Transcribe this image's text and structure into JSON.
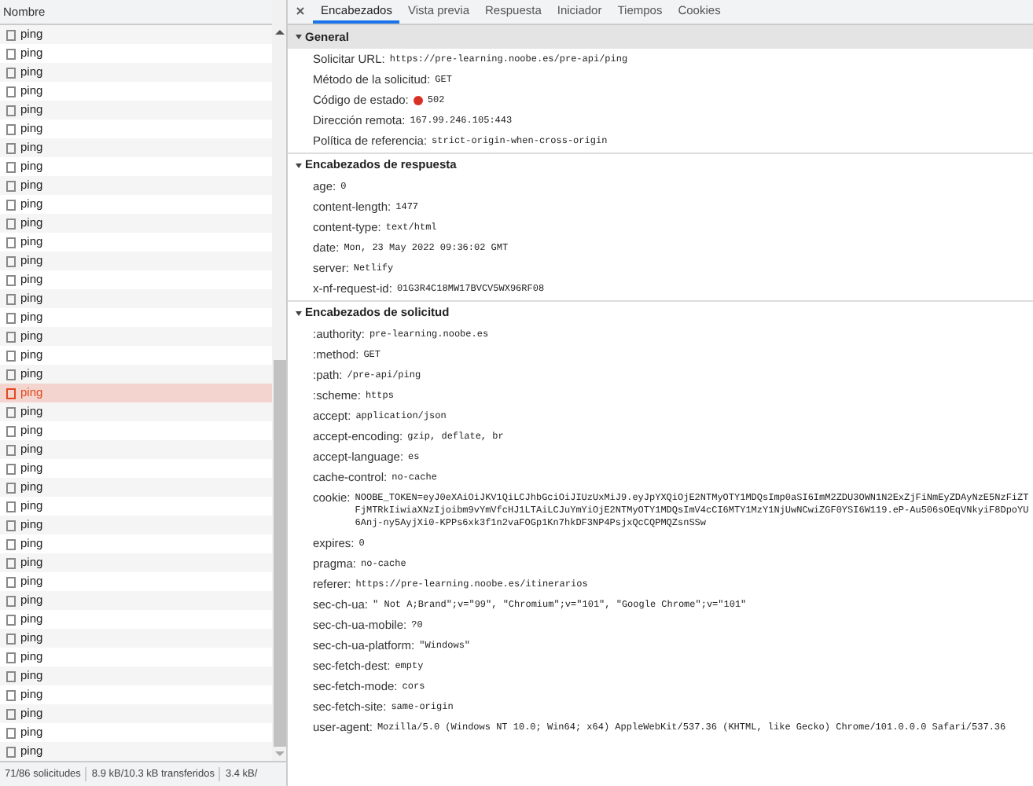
{
  "request_list": {
    "header": "Nombre",
    "rows": [
      {
        "name": "ping",
        "selected": false
      },
      {
        "name": "ping",
        "selected": false
      },
      {
        "name": "ping",
        "selected": false
      },
      {
        "name": "ping",
        "selected": false
      },
      {
        "name": "ping",
        "selected": false
      },
      {
        "name": "ping",
        "selected": false
      },
      {
        "name": "ping",
        "selected": false
      },
      {
        "name": "ping",
        "selected": false
      },
      {
        "name": "ping",
        "selected": false
      },
      {
        "name": "ping",
        "selected": false
      },
      {
        "name": "ping",
        "selected": false
      },
      {
        "name": "ping",
        "selected": false
      },
      {
        "name": "ping",
        "selected": false
      },
      {
        "name": "ping",
        "selected": false
      },
      {
        "name": "ping",
        "selected": false
      },
      {
        "name": "ping",
        "selected": false
      },
      {
        "name": "ping",
        "selected": false
      },
      {
        "name": "ping",
        "selected": false
      },
      {
        "name": "ping",
        "selected": false
      },
      {
        "name": "ping",
        "selected": true
      },
      {
        "name": "ping",
        "selected": false
      },
      {
        "name": "ping",
        "selected": false
      },
      {
        "name": "ping",
        "selected": false
      },
      {
        "name": "ping",
        "selected": false
      },
      {
        "name": "ping",
        "selected": false
      },
      {
        "name": "ping",
        "selected": false
      },
      {
        "name": "ping",
        "selected": false
      },
      {
        "name": "ping",
        "selected": false
      },
      {
        "name": "ping",
        "selected": false
      },
      {
        "name": "ping",
        "selected": false
      },
      {
        "name": "ping",
        "selected": false
      },
      {
        "name": "ping",
        "selected": false
      },
      {
        "name": "ping",
        "selected": false
      },
      {
        "name": "ping",
        "selected": false
      },
      {
        "name": "ping",
        "selected": false
      },
      {
        "name": "ping",
        "selected": false
      },
      {
        "name": "ping",
        "selected": false
      },
      {
        "name": "ping",
        "selected": false
      },
      {
        "name": "ping",
        "selected": false
      }
    ]
  },
  "status_bar": [
    "71/86 solicitudes",
    "8.9 kB/10.3 kB transferidos",
    "3.4 kB/"
  ],
  "details": {
    "tabs": [
      {
        "label": "Encabezados",
        "selected": true
      },
      {
        "label": "Vista previa",
        "selected": false
      },
      {
        "label": "Respuesta",
        "selected": false
      },
      {
        "label": "Iniciador",
        "selected": false
      },
      {
        "label": "Tiempos",
        "selected": false
      },
      {
        "label": "Cookies",
        "selected": false
      }
    ],
    "sections": [
      {
        "title": "General",
        "expanded": true,
        "focused": true,
        "rows": [
          {
            "name": "Solicitar URL:",
            "value": "https://pre-learning.noobe.es/pre-api/ping"
          },
          {
            "name": "Método de la solicitud:",
            "value": "GET"
          },
          {
            "name": "Código de estado:",
            "value": "502",
            "kind": "status"
          },
          {
            "name": "Dirección remota:",
            "value": "167.99.246.105:443"
          },
          {
            "name": "Política de referencia:",
            "value": "strict-origin-when-cross-origin"
          }
        ]
      },
      {
        "title": "Encabezados de respuesta",
        "expanded": true,
        "focused": false,
        "rows": [
          {
            "name": "age:",
            "value": "0"
          },
          {
            "name": "content-length:",
            "value": "1477"
          },
          {
            "name": "content-type:",
            "value": "text/html"
          },
          {
            "name": "date:",
            "value": "Mon, 23 May 2022 09:36:02 GMT"
          },
          {
            "name": "server:",
            "value": "Netlify"
          },
          {
            "name": "x-nf-request-id:",
            "value": "01G3R4C18MW17BVCV5WX96RF08"
          }
        ]
      },
      {
        "title": "Encabezados de solicitud",
        "expanded": true,
        "focused": false,
        "rows": [
          {
            "name": ":authority:",
            "value": "pre-learning.noobe.es"
          },
          {
            "name": ":method:",
            "value": "GET"
          },
          {
            "name": ":path:",
            "value": "/pre-api/ping"
          },
          {
            "name": ":scheme:",
            "value": "https"
          },
          {
            "name": "accept:",
            "value": "application/json"
          },
          {
            "name": "accept-encoding:",
            "value": "gzip, deflate, br"
          },
          {
            "name": "accept-language:",
            "value": "es"
          },
          {
            "name": "cache-control:",
            "value": "no-cache"
          },
          {
            "name": "cookie:",
            "value": "NOOBE_TOKEN=eyJ0eXAiOiJKV1QiLCJhbGciOiJIUzUxMiJ9.eyJpYXQiOjE2NTMyOTY1MDQsImp0aSI6ImM2ZDU3OWN1N2ExZjFiNmEyZDAyNzE5NzFiZTFjMTRkIiwiaXNzIjoibm9vYmVfcHJ1LTAiLCJuYmYiOjE2NTMyOTY1MDQsImV4cCI6MTY1MzY1NjUwNCwiZGF0YSI6W119.eP-Au506sOEqVNkyiF8DpoYU6Anj-ny5AyjXi0-KPPs6xk3f1n2vaFOGp1Kn7hkDF3NP4PsjxQcCQPMQZsnSSw"
          },
          {
            "name": "expires:",
            "value": "0"
          },
          {
            "name": "pragma:",
            "value": "no-cache"
          },
          {
            "name": "referer:",
            "value": "https://pre-learning.noobe.es/itinerarios"
          },
          {
            "name": "sec-ch-ua:",
            "value": "\" Not A;Brand\";v=\"99\", \"Chromium\";v=\"101\", \"Google Chrome\";v=\"101\""
          },
          {
            "name": "sec-ch-ua-mobile:",
            "value": "?0"
          },
          {
            "name": "sec-ch-ua-platform:",
            "value": "\"Windows\""
          },
          {
            "name": "sec-fetch-dest:",
            "value": "empty"
          },
          {
            "name": "sec-fetch-mode:",
            "value": "cors"
          },
          {
            "name": "sec-fetch-site:",
            "value": "same-origin"
          },
          {
            "name": "user-agent:",
            "value": "Mozilla/5.0 (Windows NT 10.0; Win64; x64) AppleWebKit/537.36 (KHTML, like Gecko) Chrome/101.0.0.0 Safari/537.36"
          }
        ]
      }
    ]
  }
}
